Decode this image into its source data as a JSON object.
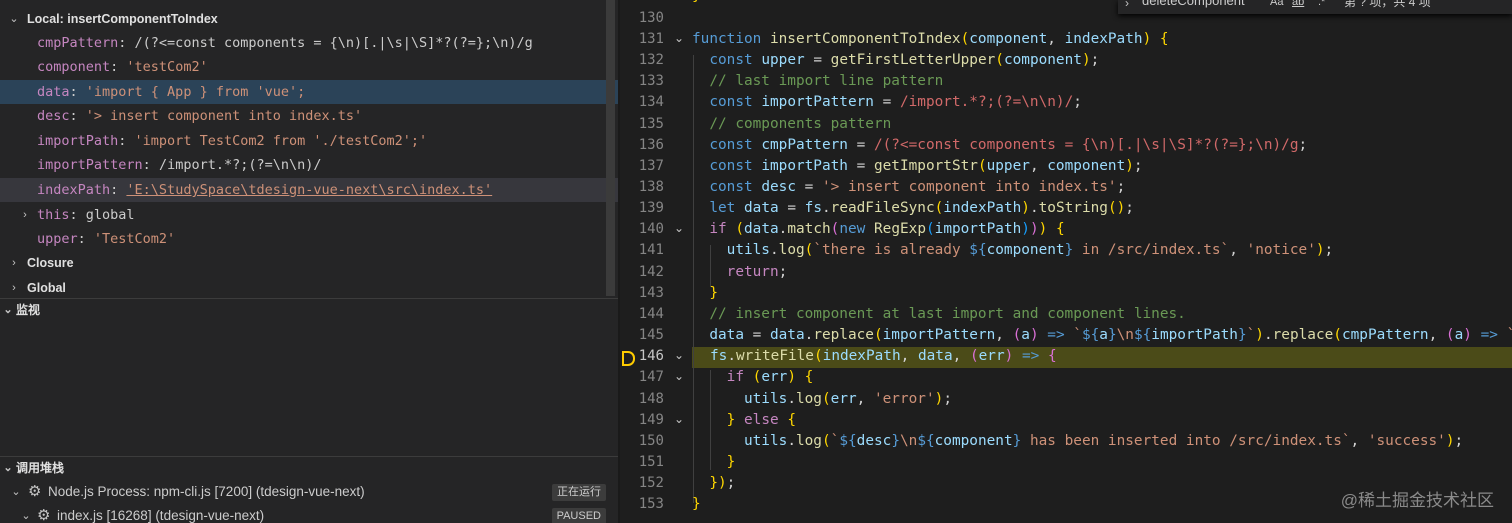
{
  "variables": {
    "local_scope_label": "Local: insertComponentToIndex",
    "items": [
      {
        "name": "cmpPattern",
        "value": "/(?<=const components = {\\n)[.|\\s|\\S]*?(?=};\\n)/g"
      },
      {
        "name": "component",
        "value": "'testCom2'"
      },
      {
        "name": "data",
        "value": "'import { App } from 'vue';"
      },
      {
        "name": "desc",
        "value": "'> insert component into index.ts'"
      },
      {
        "name": "importPath",
        "value": "'import TestCom2 from './testCom2';'"
      },
      {
        "name": "importPattern",
        "value": "/import.*?;(?=\\n\\n)/"
      },
      {
        "name": "indexPath",
        "value": "'E:\\StudySpace\\tdesign-vue-next\\src\\index.ts'"
      },
      {
        "name": "this",
        "value": "global"
      },
      {
        "name": "upper",
        "value": "'TestCom2'"
      }
    ],
    "closure_label": "Closure",
    "global_label": "Global"
  },
  "watch": {
    "label": "监视"
  },
  "callstack": {
    "label": "调用堆栈",
    "items": [
      {
        "label": "Node.js Process: npm-cli.js [7200] (tdesign-vue-next)",
        "status": "正在运行"
      },
      {
        "label": "index.js [16268] (tdesign-vue-next)",
        "status": "PAUSED"
      }
    ]
  },
  "find": {
    "query": "deleteComponent",
    "match_case": "Aa",
    "whole_word": "ab",
    "regex": ".*",
    "result": "第 ? 项，共 4 项"
  },
  "editor": {
    "current_line": 146,
    "lines": [
      {
        "n": 130,
        "text": ""
      },
      {
        "n": 131,
        "text": "function insertComponentToIndex(component, indexPath) {"
      },
      {
        "n": 132,
        "text": "  const upper = getFirstLetterUpper(component);"
      },
      {
        "n": 133,
        "text": "  // last import line pattern"
      },
      {
        "n": 134,
        "text": "  const importPattern = /import.*?;(?=\\n\\n)/;"
      },
      {
        "n": 135,
        "text": "  // components pattern"
      },
      {
        "n": 136,
        "text": "  const cmpPattern = /(?<=const components = {\\n)[.|\\s|\\S]*?(?=};\\n)/g;"
      },
      {
        "n": 137,
        "text": "  const importPath = getImportStr(upper, component);"
      },
      {
        "n": 138,
        "text": "  const desc = '> insert component into index.ts';"
      },
      {
        "n": 139,
        "text": "  let data = fs.readFileSync(indexPath).toString();"
      },
      {
        "n": 140,
        "text": "  if (data.match(new RegExp(importPath))) {"
      },
      {
        "n": 141,
        "text": "    utils.log(`there is already ${component} in /src/index.ts`, 'notice');"
      },
      {
        "n": 142,
        "text": "    return;"
      },
      {
        "n": 143,
        "text": "  }"
      },
      {
        "n": 144,
        "text": "  // insert component at last import and component lines."
      },
      {
        "n": 145,
        "text": "  data = data.replace(importPattern, (a) => `${a}\\n${importPath}`).replace(cmpPattern, (a) => `$"
      },
      {
        "n": 146,
        "text": "fs.writeFile(indexPath, data, (err) => {"
      },
      {
        "n": 147,
        "text": "    if (err) {"
      },
      {
        "n": 148,
        "text": "      utils.log(err, 'error');"
      },
      {
        "n": 149,
        "text": "    } else {"
      },
      {
        "n": 150,
        "text": "      utils.log(`${desc}\\n${component} has been inserted into /src/index.ts`, 'success');"
      },
      {
        "n": 151,
        "text": "    }"
      },
      {
        "n": 152,
        "text": "  });"
      },
      {
        "n": 153,
        "text": "}"
      }
    ]
  },
  "watermark": "@稀土掘金技术社区",
  "colors": {
    "panel_bg": "#252526",
    "editor_bg": "#1e1e1e",
    "keyword": "#569cd6",
    "function": "#dcdcaa",
    "variable": "#9cdcfe",
    "string": "#ce9178",
    "regex": "#d16969",
    "comment": "#6a9955",
    "current_line_bg": "#4b4b18",
    "breakpoint": "#ffcc00"
  }
}
